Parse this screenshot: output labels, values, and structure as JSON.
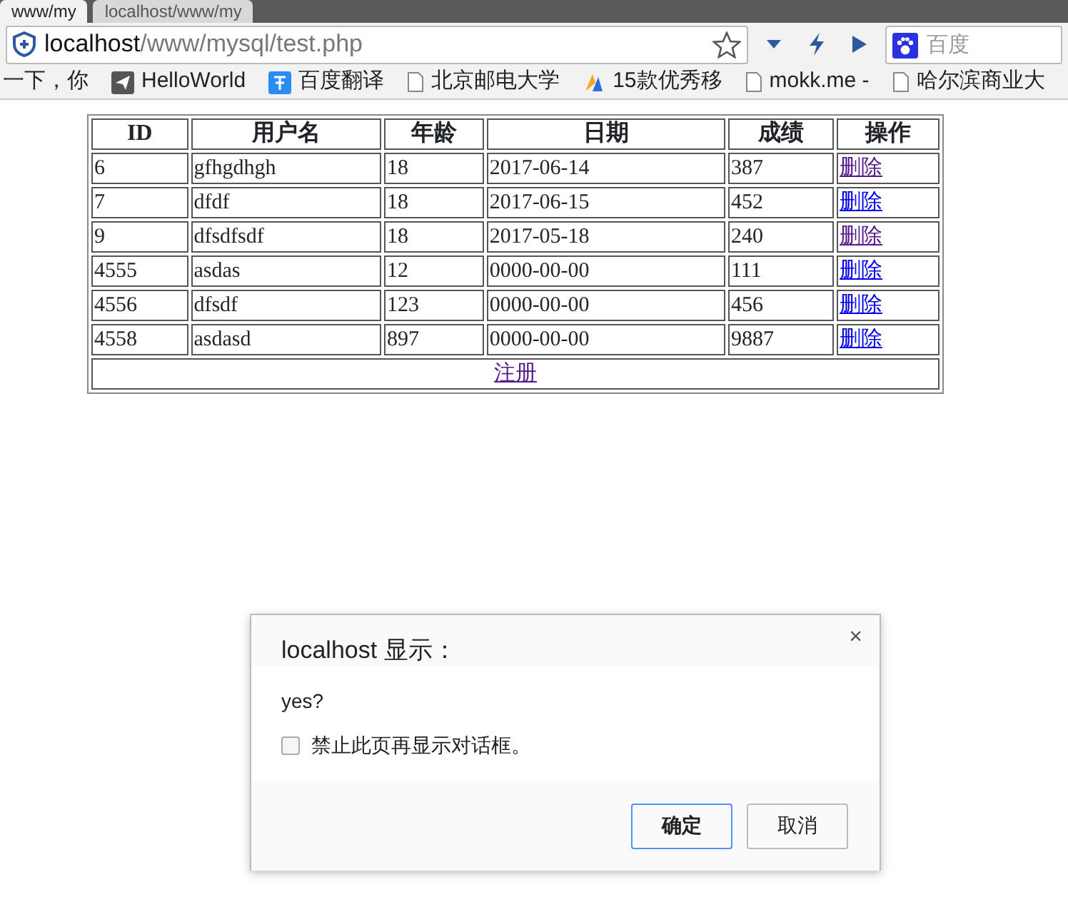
{
  "browser": {
    "tabs": [
      {
        "title": "www/my",
        "selected": true
      },
      {
        "title": "localhost/www/my",
        "selected": false
      }
    ],
    "address": {
      "host": "localhost",
      "path": "/www/mysql/test.php"
    },
    "search": {
      "placeholder": "百度"
    },
    "bookmarks": [
      {
        "label": "一下，你"
      },
      {
        "label": "HelloWorld"
      },
      {
        "label": "百度翻译"
      },
      {
        "label": "北京邮电大学"
      },
      {
        "label": "15款优秀移"
      },
      {
        "label": "mokk.me -"
      },
      {
        "label": "哈尔滨商业大"
      }
    ]
  },
  "table": {
    "columns": [
      "ID",
      "用户名",
      "年龄",
      "日期",
      "成绩",
      "操作"
    ],
    "rows": [
      {
        "cells": [
          "6",
          "gfhgdhgh",
          "18",
          "2017-06-14",
          "387"
        ],
        "action": "删除",
        "visited": true
      },
      {
        "cells": [
          "7",
          "dfdf",
          "18",
          "2017-06-15",
          "452"
        ],
        "action": "删除",
        "visited": false
      },
      {
        "cells": [
          "9",
          "dfsdfsdf",
          "18",
          "2017-05-18",
          "240"
        ],
        "action": "删除",
        "visited": true
      },
      {
        "cells": [
          "4555",
          "asdas",
          "12",
          "0000-00-00",
          "111"
        ],
        "action": "删除",
        "visited": false
      },
      {
        "cells": [
          "4556",
          "dfsdf",
          "123",
          "0000-00-00",
          "456"
        ],
        "action": "删除",
        "visited": false
      },
      {
        "cells": [
          "4558",
          "asdasd",
          "897",
          "0000-00-00",
          "9887"
        ],
        "action": "删除",
        "visited": false
      }
    ],
    "footer_link": {
      "label": "注册",
      "visited": true
    }
  },
  "dialog": {
    "title": "localhost 显示：",
    "message": "yes?",
    "checkbox": {
      "label": "禁止此页再显示对话框。",
      "checked": false
    },
    "close": "×",
    "buttons": [
      {
        "label": "确定",
        "primary": true
      },
      {
        "label": "取消",
        "primary": false
      }
    ]
  }
}
